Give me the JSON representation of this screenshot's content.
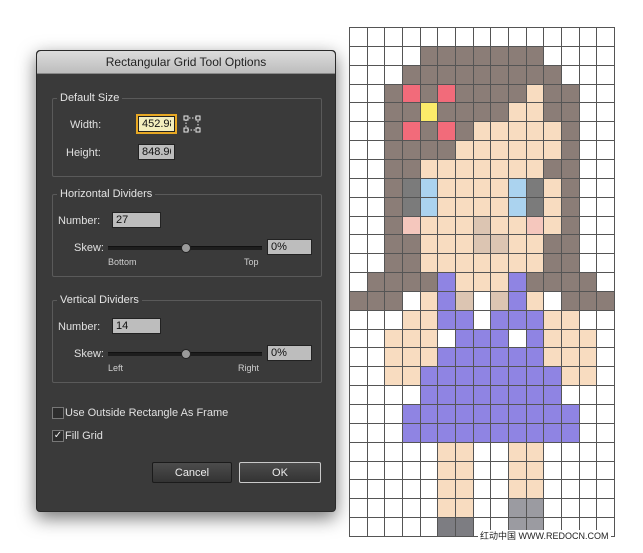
{
  "dialog": {
    "title": "Rectangular Grid Tool Options",
    "default_size": {
      "title": "Default Size",
      "width_label": "Width:",
      "width_value": "452.98 px",
      "height_label": "Height:",
      "height_value": "848.96 px"
    },
    "horizontal": {
      "title": "Horizontal Dividers",
      "number_label": "Number:",
      "number_value": "27",
      "skew_label": "Skew:",
      "skew_value": "0%",
      "skew_min_label": "Bottom",
      "skew_max_label": "Top"
    },
    "vertical": {
      "title": "Vertical Dividers",
      "number_label": "Number:",
      "number_value": "14",
      "skew_label": "Skew:",
      "skew_value": "0%",
      "skew_min_label": "Left",
      "skew_max_label": "Right"
    },
    "options": {
      "use_outside_label": "Use Outside Rectangle As Frame",
      "use_outside_checked": false,
      "fill_grid_label": "Fill Grid",
      "fill_grid_checked": true
    },
    "buttons": {
      "cancel": "Cancel",
      "ok": "OK"
    }
  },
  "artwork": {
    "columns": 15,
    "rows": 27,
    "palette": {
      ".": "#ffffff",
      "H": "#8b7d77",
      "S": "#f8dcc0",
      "P": "#f26b7a",
      "Y": "#fbeb6a",
      "E": "#abd3ef",
      "D": "#7b7b7b",
      "C": "#f5c7bd",
      "M": "#dcc5b2",
      "B": "#8f84e3",
      "W": "#ffffff",
      "G": "#9b9ba1",
      "K": "#7d7d82"
    },
    "pixels": [
      "...............",
      "....HHHHHHH....",
      "...HHHHHHHHH...",
      "..HPHPHHHHSHH..",
      "..HHYHHHHSSHH..",
      "..HPHPHSSSSSH..",
      "..HHHHSSSSSSH..",
      "..HHSSSSSSSHH..",
      "..HDESSSSEDSH..",
      "..HDESSSSEDSH..",
      "..HCSSSMSSCSH..",
      "..HHSSSMMSSHH..",
      "..HHSSSSSSSHH..",
      ".HHHHBSSSBHHHH.",
      "HHH.SBMWMBS.HHH",
      "...SSBBWBBBSS..",
      "..SSSWBBBWBSSS.",
      "..SSSBBBBBBSSS.",
      "..SSBBBBBBBBSS.",
      "....BBBBBBBB...",
      "...BBBBBBBBBB..",
      "...BBBBBBBBBB..",
      ".....SS..SS....",
      ".....SS..SS....",
      ".....SS..SS....",
      ".....SS..GG....",
      ".....KK..GG...."
    ]
  },
  "watermark": "红动中国 WWW.REDOCN.COM"
}
